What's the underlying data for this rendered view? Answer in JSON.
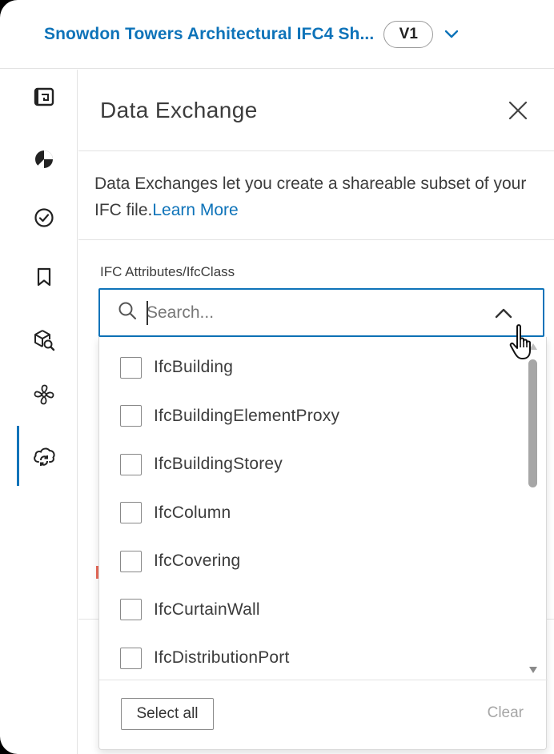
{
  "header": {
    "model_title": "Snowdon Towers Architectural IFC4 Sh...",
    "version": "V1"
  },
  "rail": {
    "items": [
      {
        "icon": "sheets-icon"
      },
      {
        "icon": "model-browser-icon"
      },
      {
        "icon": "issues-icon"
      },
      {
        "icon": "bookmark-icon"
      },
      {
        "icon": "model-search-icon"
      },
      {
        "icon": "fan-icon"
      },
      {
        "icon": "data-exchange-icon",
        "active": true
      }
    ]
  },
  "panel": {
    "title": "Data Exchange",
    "intro_text": "Data Exchanges let you create a shareable subset of your IFC file.",
    "learn_more": "Learn More",
    "field_label": "IFC Attributes/IfcClass",
    "search_placeholder": "Search..."
  },
  "dropdown": {
    "options": [
      "IfcBuilding",
      "IfcBuildingElementProxy",
      "IfcBuildingStorey",
      "IfcColumn",
      "IfcCovering",
      "IfcCurtainWall",
      "IfcDistributionPort"
    ],
    "select_all": "Select all",
    "clear": "Clear"
  },
  "colors": {
    "accent": "#0e73b9",
    "border": "#e3e3e3",
    "text": "#3c3c3c"
  }
}
